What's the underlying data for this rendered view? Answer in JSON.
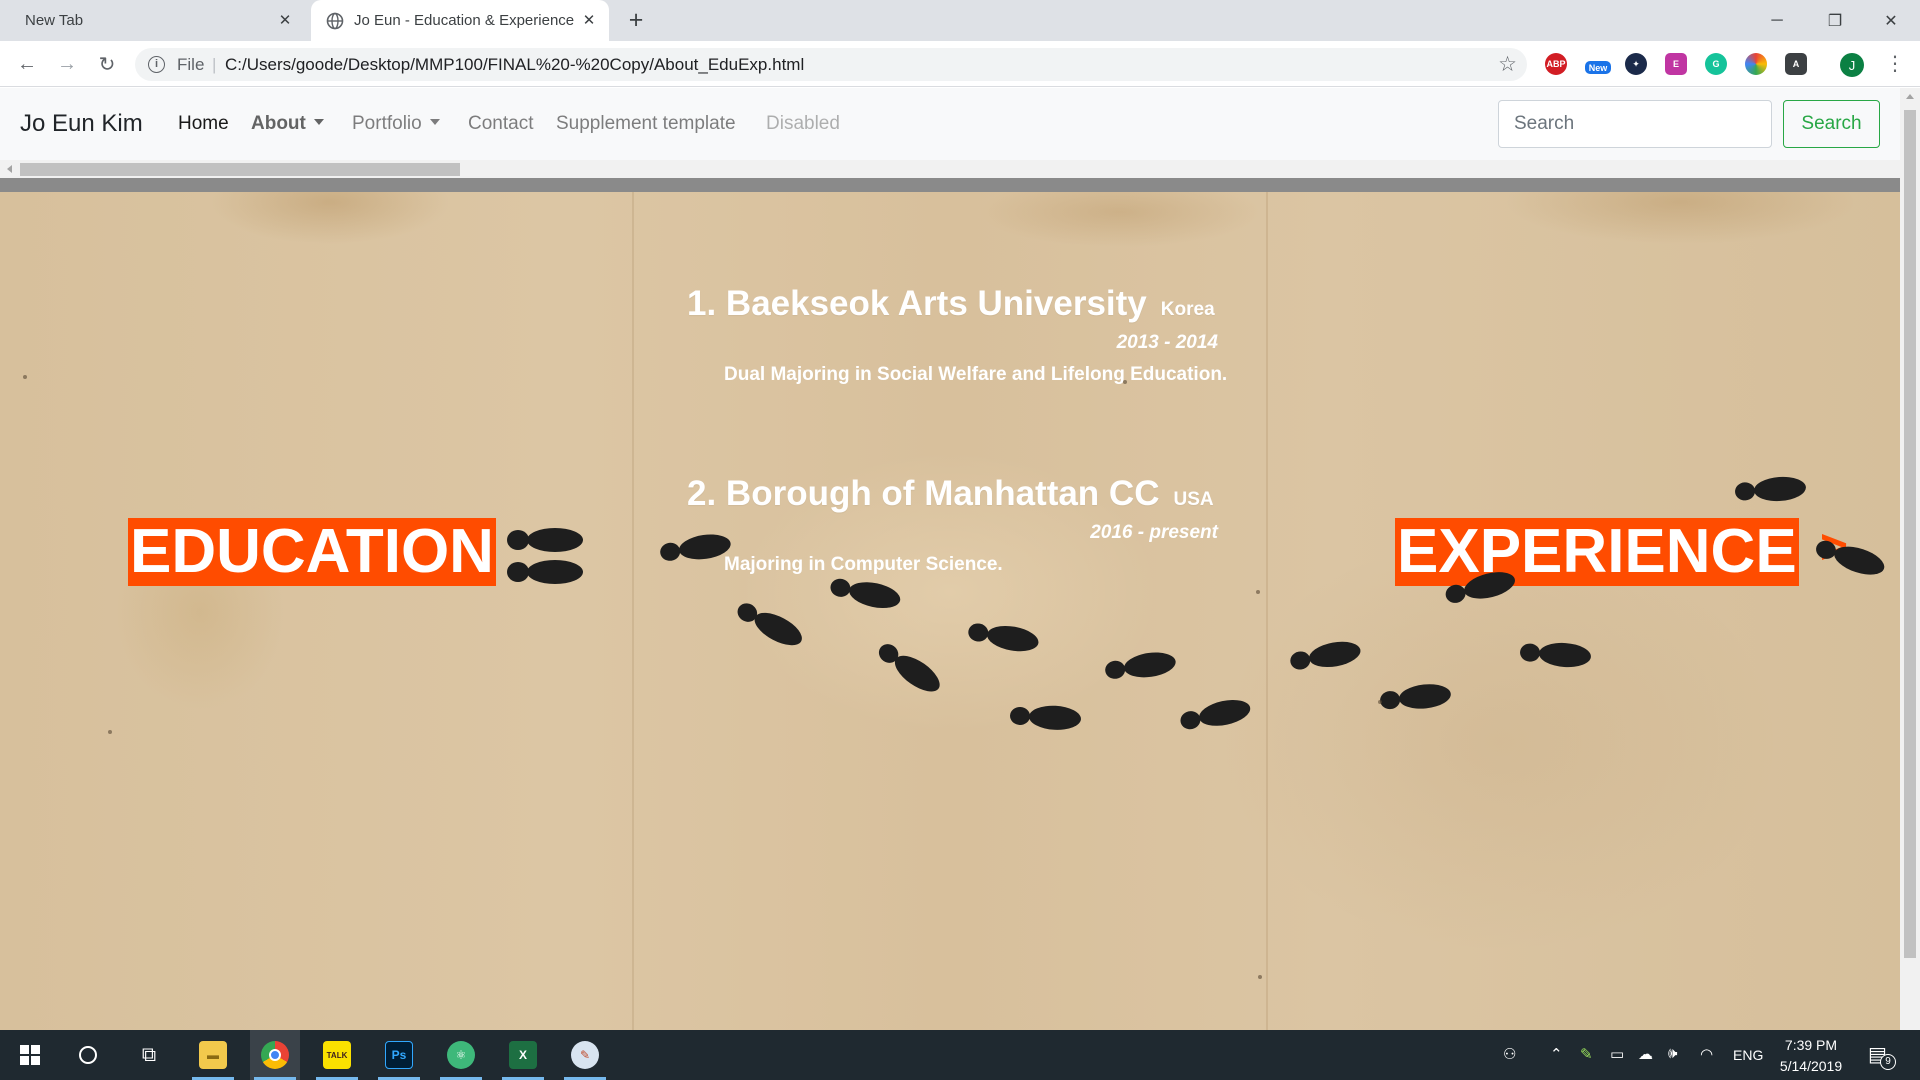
{
  "browser": {
    "tabs": [
      {
        "title": "New Tab",
        "active": false
      },
      {
        "title": "Jo Eun - Education & Experience",
        "active": true
      }
    ],
    "address": {
      "scheme": "File",
      "url": "C:/Users/goode/Desktop/MMP100/FINAL%20-%20Copy/About_EduExp.html"
    },
    "extensions": [
      {
        "name": "abp-icon",
        "label": "ABP",
        "color": "#d21d24"
      },
      {
        "name": "new-extension-icon",
        "label": "New",
        "color": "#1a73e8"
      },
      {
        "name": "compass-extension-icon",
        "label": "",
        "color": "#1b2a4a"
      },
      {
        "name": "e-extension-icon",
        "label": "E",
        "color": "#c035a2"
      },
      {
        "name": "grammarly-icon",
        "label": "G",
        "color": "#15c39a"
      },
      {
        "name": "color-picker-icon",
        "label": "",
        "color": "#e8a317"
      },
      {
        "name": "a-extension-icon",
        "label": "A",
        "color": "#3c4043"
      }
    ],
    "profile_initial": "J"
  },
  "navbar": {
    "brand": "Jo Eun Kim",
    "links": {
      "home": "Home",
      "about": "About",
      "portfolio": "Portfolio",
      "contact": "Contact",
      "supplement": "Supplement template",
      "disabled": "Disabled"
    },
    "search_placeholder": "Search",
    "search_button": "Search"
  },
  "content": {
    "education_label": "EDUCATION",
    "experience_label": "EXPERIENCE",
    "next_arrow": ">",
    "schools": [
      {
        "name": "1. Baekseok Arts University",
        "country": "Korea",
        "years": "2013 - 2014",
        "major": "Dual Majoring in Social Welfare and Lifelong Education."
      },
      {
        "name": "2. Borough of Manhattan CC",
        "country": "USA",
        "years": "2016 - present",
        "major": "Majoring in Computer Science."
      }
    ],
    "accent_color": "#ff4c00"
  },
  "taskbar": {
    "apps": [
      {
        "name": "start-icon"
      },
      {
        "name": "cortana-icon"
      },
      {
        "name": "task-view-icon"
      },
      {
        "name": "file-explorer-icon"
      },
      {
        "name": "chrome-icon"
      },
      {
        "name": "kakaotalk-icon",
        "label": "TALK"
      },
      {
        "name": "photoshop-icon",
        "label": "Ps"
      },
      {
        "name": "atom-icon"
      },
      {
        "name": "excel-icon",
        "label": "X"
      },
      {
        "name": "paint-icon"
      }
    ],
    "language": "ENG",
    "time": "7:39 PM",
    "date": "5/14/2019",
    "notification_count": "9"
  }
}
